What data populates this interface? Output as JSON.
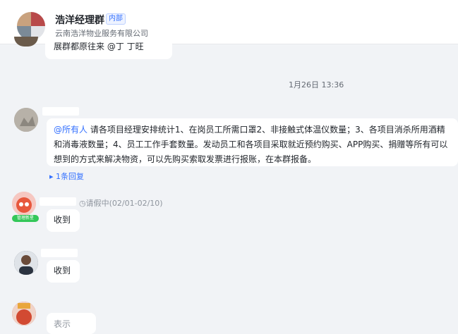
{
  "header": {
    "title": "浩洋经理群",
    "badge": "内部",
    "subtitle": "云南浩洋物业服务有限公司"
  },
  "messages": {
    "top_partial": "展群都原往来  @丁  丁旺",
    "timestamp": "1月26日 13:36",
    "announcement": {
      "mention": "@所有人",
      "text": " 请各项目经理安排统计1、在岗员工所需口罩2、非接触式体温仪数量；3、各项目消杀所用酒精和消毒液数量；4、员工工作手套数量。发动员工和各项目采取就近预约购买、APP购买、捐赠等所有可以想到的方式来解决物资，可以先购买索取发票进行报账，在本群报备。",
      "reply_label": "1条回复"
    },
    "msg2": {
      "status": "请假中(02/01-02/10)",
      "badge": "管理新星",
      "text": "收到"
    },
    "msg3": {
      "text": "收到"
    },
    "msg4": {
      "partial_text": "表示"
    }
  }
}
